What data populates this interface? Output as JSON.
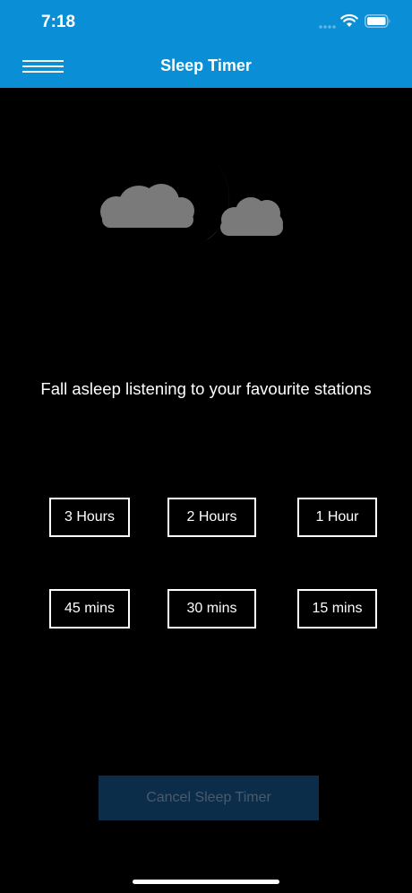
{
  "status_bar": {
    "time": "7:18"
  },
  "nav": {
    "title": "Sleep Timer",
    "menu_icon": "hamburger-icon"
  },
  "hero": {
    "icon": "moon-clouds-icon"
  },
  "tagline": "Fall asleep listening to your favourite stations",
  "timer_options": [
    "3 Hours",
    "2 Hours",
    "1 Hour",
    "45 mins",
    "30 mins",
    "15 mins"
  ],
  "cancel_button": {
    "label": "Cancel Sleep Timer",
    "state": "disabled"
  },
  "colors": {
    "header": "#0a8fd6",
    "background": "#000000",
    "cancel_bg": "#0c2d4a",
    "cancel_text": "#4a5a6a"
  }
}
